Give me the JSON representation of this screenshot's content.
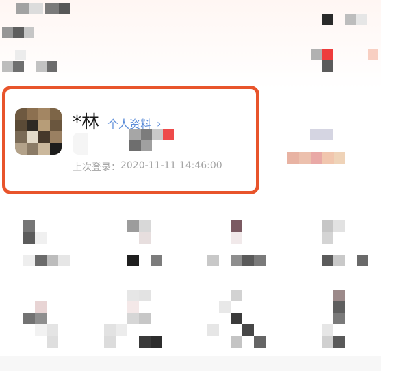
{
  "profile": {
    "name": "*林",
    "profile_link": "个人资料",
    "chevron_icon": "chevron-right-icon",
    "last_login_label": "上次登录：",
    "last_login_time": "2020-11-11 14:46:00"
  },
  "colors": {
    "card_border": "#e8542b",
    "link": "#5b8cd8",
    "muted_text": "#a5a5a5"
  }
}
